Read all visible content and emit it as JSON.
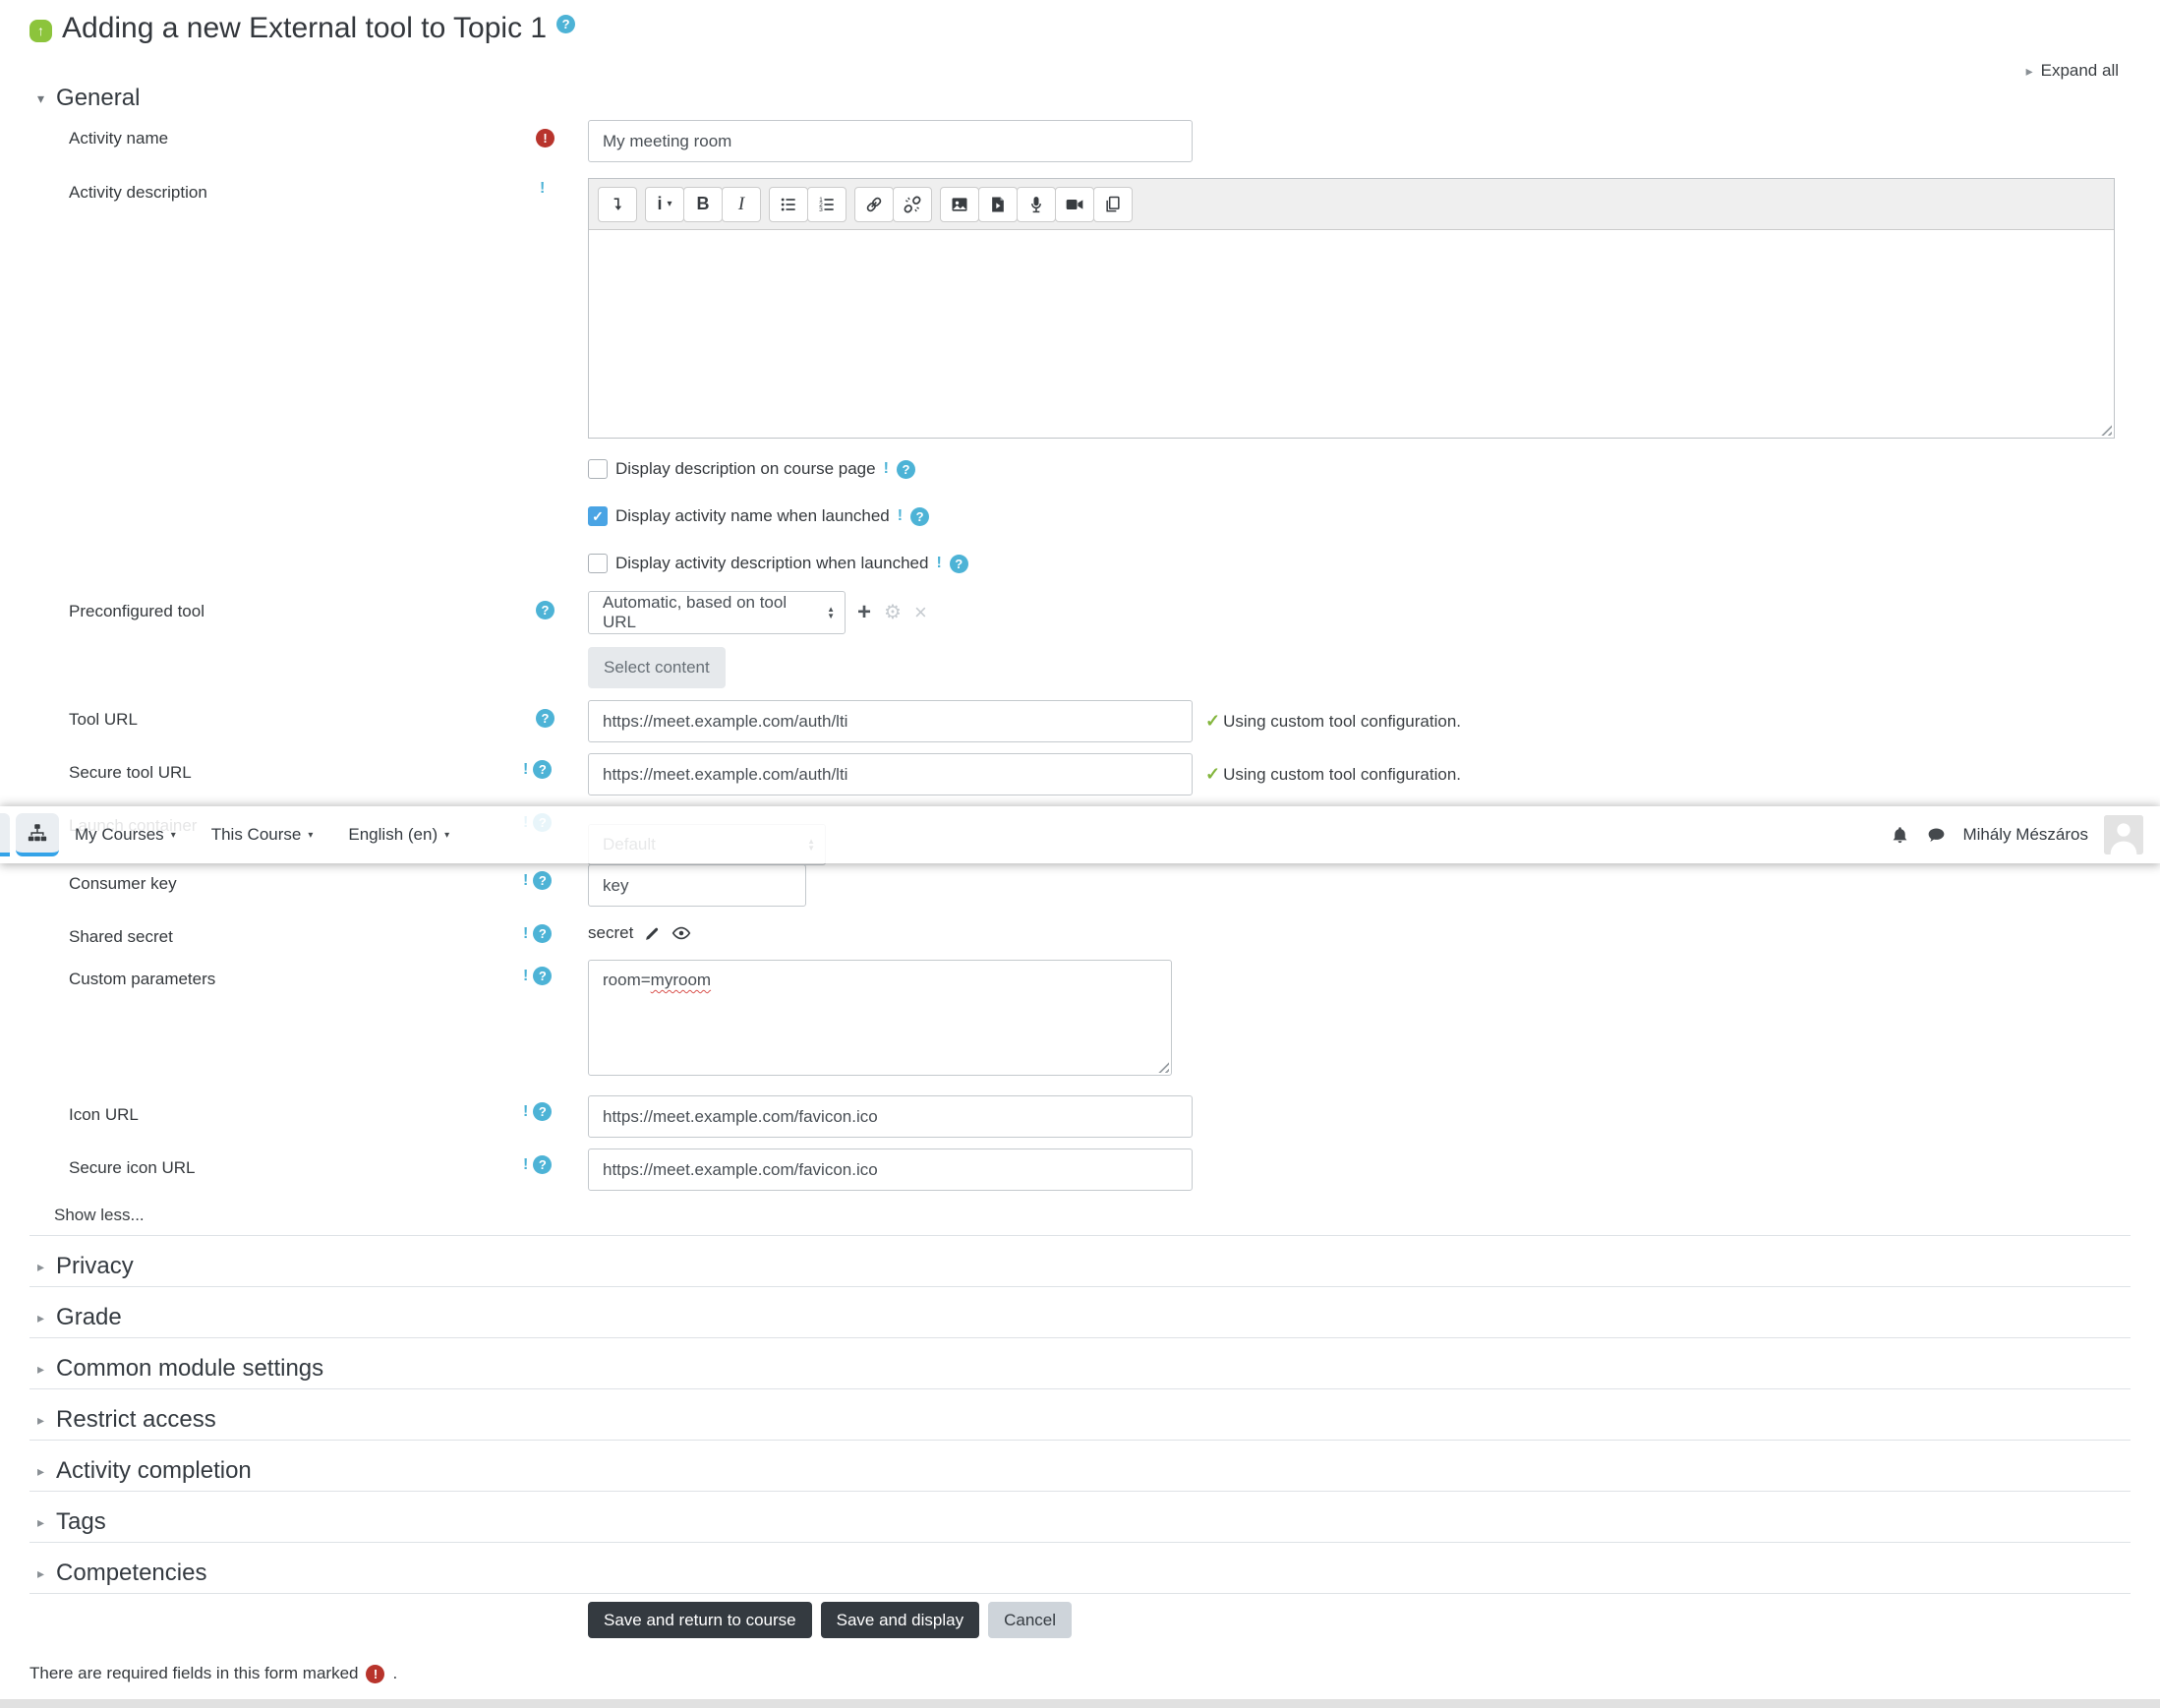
{
  "page": {
    "title": "Adding a new External tool to Topic 1",
    "expand_all": "Expand all",
    "show_less": "Show less...",
    "required_note": "There are required fields in this form marked",
    "required_note_period": "."
  },
  "navbar": {
    "menus": [
      {
        "label": "My Courses"
      },
      {
        "label": "This Course"
      },
      {
        "label": "English (en)"
      }
    ],
    "user_name": "Mihály Mészáros"
  },
  "sections": {
    "general": "General",
    "collapsed": [
      "Privacy",
      "Grade",
      "Common module settings",
      "Restrict access",
      "Activity completion",
      "Tags",
      "Competencies"
    ]
  },
  "form": {
    "activity_name": {
      "label": "Activity name",
      "value": "My meeting room"
    },
    "activity_description": {
      "label": "Activity description",
      "value": ""
    },
    "checkboxes": [
      {
        "label": "Display description on course page",
        "checked": false
      },
      {
        "label": "Display activity name when launched",
        "checked": true
      },
      {
        "label": "Display activity description when launched",
        "checked": false
      }
    ],
    "preconfigured_tool": {
      "label": "Preconfigured tool",
      "value": "Automatic, based on tool URL",
      "select_content": "Select content"
    },
    "tool_url": {
      "label": "Tool URL",
      "value": "https://meet.example.com/auth/lti",
      "status": "Using custom tool configuration."
    },
    "secure_tool_url": {
      "label": "Secure tool URL",
      "value": "https://meet.example.com/auth/lti",
      "status": "Using custom tool configuration."
    },
    "launch_container": {
      "label": "Launch container",
      "value": "Default"
    },
    "consumer_key": {
      "label": "Consumer key",
      "value": "key"
    },
    "shared_secret": {
      "label": "Shared secret",
      "value": "secret"
    },
    "custom_parameters": {
      "label": "Custom parameters",
      "value_prefix": "room=",
      "value_misspelled": "myroom"
    },
    "icon_url": {
      "label": "Icon URL",
      "value": "https://meet.example.com/favicon.ico"
    },
    "secure_icon_url": {
      "label": "Secure icon URL",
      "value": "https://meet.example.com/favicon.ico"
    }
  },
  "editor": {
    "styles_letter": "i",
    "bold": "B",
    "italic": "I"
  },
  "buttons": {
    "save_return": "Save and return to course",
    "save_display": "Save and display",
    "cancel": "Cancel"
  },
  "icons": {
    "question": "?",
    "exclaim": "!",
    "check": "✓",
    "plus": "+",
    "gear": "⚙",
    "close": "×",
    "caret_down": "▾",
    "caret_right": "▸",
    "up_arrow": "↑",
    "arrow_up_small": "▲",
    "arrow_down_small": "▼"
  },
  "colors": {
    "accent_blue": "#34a3e8",
    "help_blue": "#4db3d6",
    "required_red": "#b8342c",
    "check_green": "#84b63e",
    "activity_green": "#8cc43c",
    "dark_button": "#343a40"
  }
}
